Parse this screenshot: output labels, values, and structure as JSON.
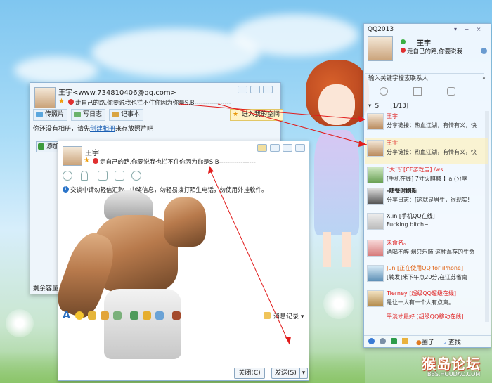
{
  "desktop": {
    "watermark_logo": "猴岛论坛",
    "watermark_url": "BBS.HOUDAO.COM"
  },
  "qq_panel": {
    "title": "QQ2013",
    "nickname": "王宇",
    "signature": "走自己的路,你要说我",
    "search_placeholder": "输入关键字搜索联系人",
    "group_label": "S",
    "group_count": "[1/13]",
    "contacts": [
      {
        "name": "王宇",
        "status": "分享链接：热血江湖，有情有义，快",
        "name_color": "#e02020"
      },
      {
        "name": "王宇",
        "status": "分享链接：热血江湖，有情有义，快",
        "name_color": "#e02020"
      },
      {
        "name": "`大飞`[CF游戏店] /ws",
        "status": "[手机在线] 7寸火麒麟 】a (分享",
        "name_color": "#e02020"
      },
      {
        "name": "-随餐时刷新",
        "status": "分享日志：[这就是男生，很现实!",
        "name_color": "#222222"
      },
      {
        "name": "X,in  [手机QQ在线]",
        "status": "Fucking bitch~",
        "name_color": "#222222"
      },
      {
        "name": "未命名。",
        "status": "酒喝不醉 烟只乐肺 这种温存的生命",
        "name_color": "#e02020"
      },
      {
        "name": "Jun  [正在使用QQ for iPhone]",
        "status": "[转发]米下午点20分,在江苏省南",
        "name_color": "#e06010"
      },
      {
        "name": "Tierney  [超级QQ超级在线]",
        "status": "是让一人有一个人有点爽。",
        "name_color": "#e02020"
      },
      {
        "name": "平淡才最好  [超级QQ移动在线]",
        "status": "",
        "name_color": "#e02020"
      }
    ],
    "bottom_circle_label": "圈子",
    "bottom_find_label": "查找"
  },
  "profile_window": {
    "title": "王宇<www.734810406@qq.com>",
    "signature": "走自己的路,你要说我也拦不住你因为你是S.B-----------------",
    "tabs": [
      "传照片",
      "写日志",
      "记事本"
    ],
    "space_link": "进入我的空间",
    "album_text_before": "你还没有相册，请先",
    "album_link": "创建相册",
    "album_text_after": "来存放照片吧",
    "add_button": "添加",
    "remaining_label": "剩余容量："
  },
  "chat_window": {
    "contact_name": "王宇",
    "signature": "走自己的路,你要说我也拦不住你因为你是S.B-----------------",
    "security_notice": "交谈中请勿轻信汇款、中奖信息，勿轻易拨打陌生电话，勿使用外挂软件。",
    "message_log_label": "消息记录",
    "close_button": "关闭(C)",
    "send_button": "发送(S)"
  }
}
